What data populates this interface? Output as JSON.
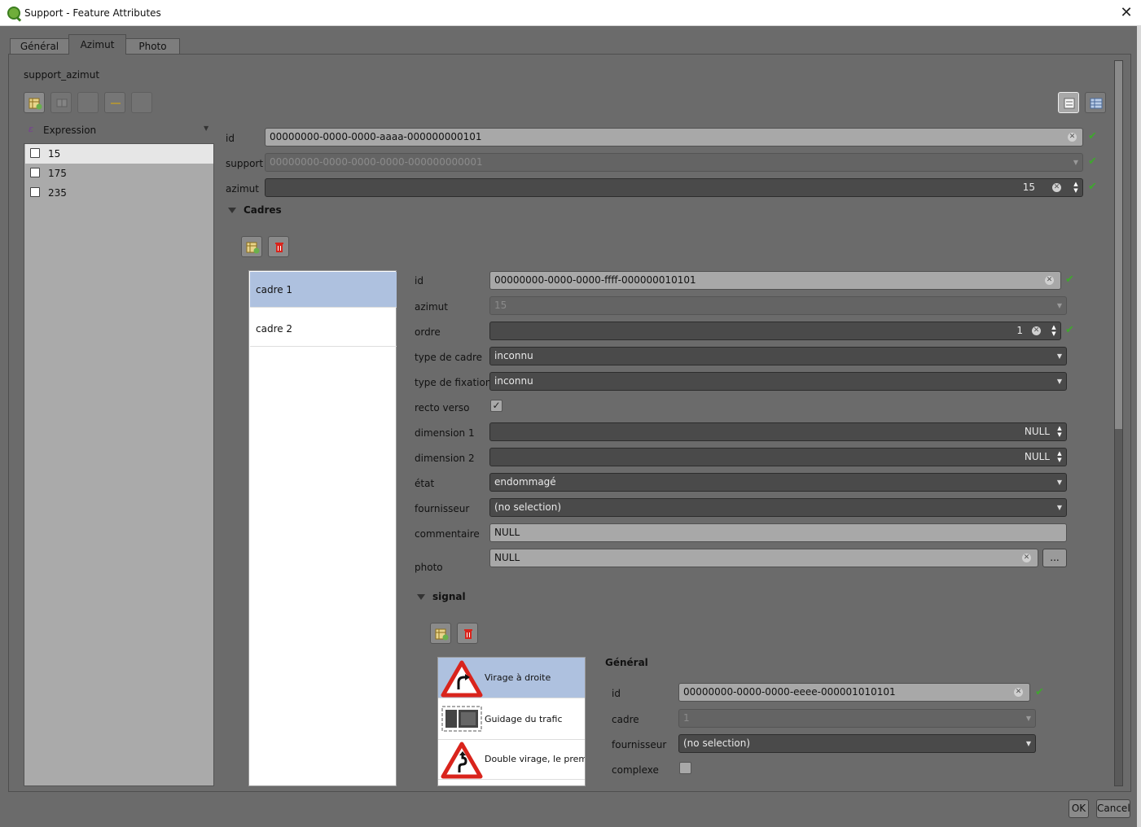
{
  "window": {
    "title": "Support - Feature Attributes",
    "close": "✕"
  },
  "tabs": [
    "Général",
    "Azimut",
    "Photo"
  ],
  "section_title": "support_azimut",
  "expression": {
    "label": "Expression"
  },
  "list_items": [
    "15",
    "175",
    "235"
  ],
  "form": {
    "id_label": "id",
    "id_value": "00000000-0000-0000-aaaa-000000000101",
    "support_label": "support",
    "support_value": "00000000-0000-0000-0000-000000000001",
    "azimut_label": "azimut",
    "azimut_value": "15"
  },
  "cadres": {
    "title": "Cadres",
    "items": [
      "cadre 1",
      "cadre 2"
    ],
    "form": {
      "id_label": "id",
      "id_value": "00000000-0000-0000-ffff-000000010101",
      "azimut_label": "azimut",
      "azimut_value": "15",
      "ordre_label": "ordre",
      "ordre_value": "1",
      "type_cadre_label": "type de cadre",
      "type_cadre_value": "inconnu",
      "type_fixation_label": "type de fixation",
      "type_fixation_value": "inconnu",
      "recto_verso_label": "recto verso",
      "dimension1_label": "dimension 1",
      "dimension1_value": "NULL",
      "dimension2_label": "dimension 2",
      "dimension2_value": "NULL",
      "etat_label": "état",
      "etat_value": "endommagé",
      "fournisseur_label": "fournisseur",
      "fournisseur_value": "(no selection)",
      "commentaire_label": "commentaire",
      "commentaire_value": "NULL",
      "photo_label": "photo",
      "photo_value": "NULL",
      "browse_label": "..."
    }
  },
  "signal": {
    "title": "signal",
    "items": [
      "Virage à droite",
      "Guidage du trafic",
      "Double virage, le premier"
    ],
    "general_title": "Général",
    "form": {
      "id_label": "id",
      "id_value": "00000000-0000-0000-eeee-000001010101",
      "cadre_label": "cadre",
      "cadre_value": "1",
      "fournisseur_label": "fournisseur",
      "fournisseur_value": "(no selection)",
      "complexe_label": "complexe"
    }
  },
  "buttons": {
    "ok": "OK",
    "cancel": "Cancel"
  },
  "colors": {
    "accent": "#3fa72e",
    "selection": "#aec1df",
    "sign_red": "#d9241c"
  }
}
